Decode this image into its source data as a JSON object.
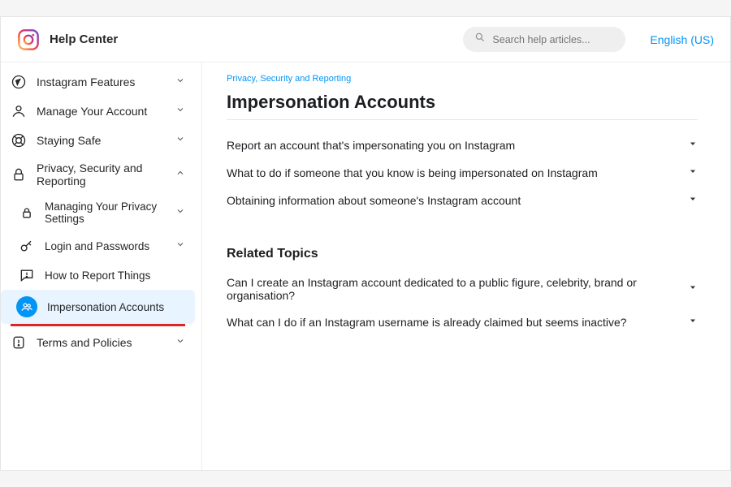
{
  "header": {
    "brand": "Help Center",
    "search_placeholder": "Search help articles...",
    "language": "English (US)"
  },
  "sidebar": {
    "items": [
      {
        "label": "Instagram Features"
      },
      {
        "label": "Manage Your Account"
      },
      {
        "label": "Staying Safe"
      },
      {
        "label": "Privacy, Security and Reporting"
      },
      {
        "label": "Terms and Policies"
      }
    ],
    "subitems": [
      {
        "label": "Managing Your Privacy Settings"
      },
      {
        "label": "Login and Passwords"
      },
      {
        "label": "How to Report Things"
      },
      {
        "label": "Impersonation Accounts"
      }
    ]
  },
  "main": {
    "breadcrumb": "Privacy, Security and Reporting",
    "title": "Impersonation Accounts",
    "faq": [
      "Report an account that's impersonating you on Instagram",
      "What to do if someone that you know is being impersonated on Instagram",
      "Obtaining information about someone's Instagram account"
    ],
    "related_title": "Related Topics",
    "related": [
      "Can I create an Instagram account dedicated to a public figure, celebrity, brand or organisation?",
      "What can I do if an Instagram username is already claimed but seems inactive?"
    ]
  }
}
